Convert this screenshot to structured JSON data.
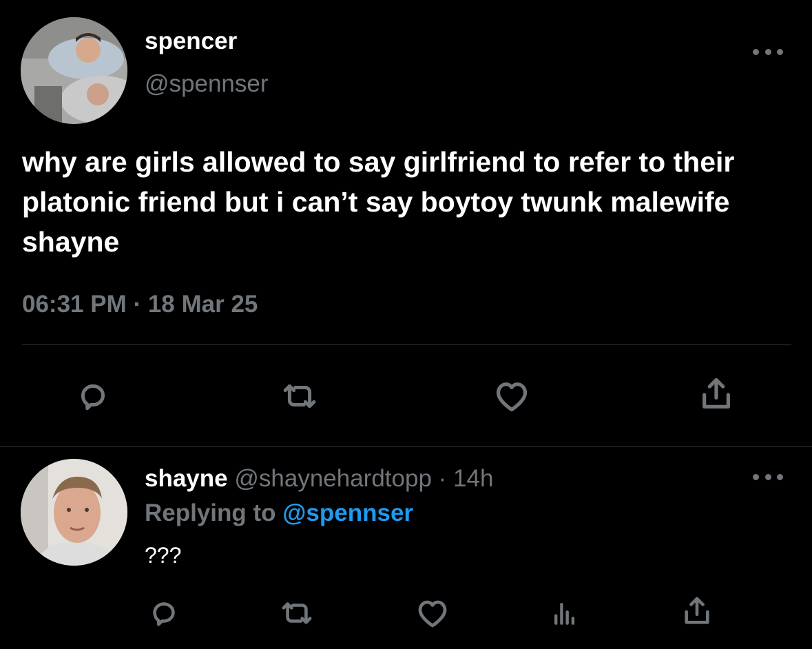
{
  "tweet": {
    "display_name": "spencer",
    "handle": "@spennser",
    "text": "why are girls allowed to say girlfriend to refer to their platonic friend but i can’t say boytoy twunk malewife shayne",
    "timestamp": "06:31 PM · 18 Mar 25",
    "actions": [
      "reply-icon",
      "retweet-icon",
      "like-icon",
      "share-icon"
    ]
  },
  "reply": {
    "display_name": "shayne",
    "handle": "@shaynehardtopp",
    "separator": "·",
    "age": "14h",
    "replying_prefix": "Replying to",
    "replying_handle": "@spennser",
    "text": "???",
    "actions": [
      "reply-icon",
      "retweet-icon",
      "like-icon",
      "analytics-icon",
      "share-icon"
    ]
  },
  "colors": {
    "background": "#000000",
    "text": "#ffffff",
    "muted": "#71767b",
    "link": "#1d9bf0",
    "divider": "#2f3336"
  }
}
